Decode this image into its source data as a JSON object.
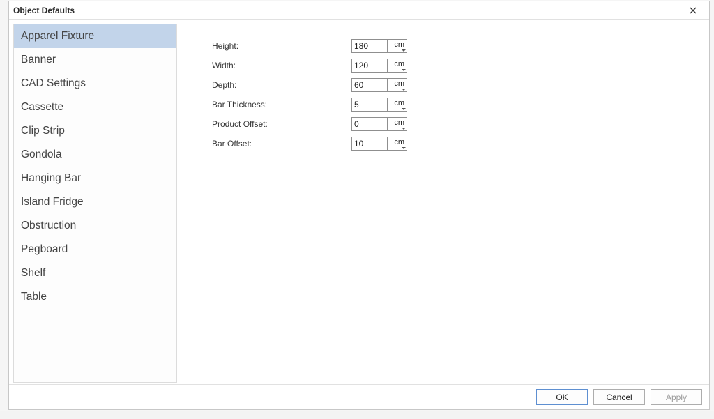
{
  "window": {
    "title": "Object Defaults"
  },
  "sidebar": {
    "items": [
      {
        "label": "Apparel Fixture",
        "selected": true
      },
      {
        "label": "Banner"
      },
      {
        "label": "CAD Settings"
      },
      {
        "label": "Cassette"
      },
      {
        "label": "Clip Strip"
      },
      {
        "label": "Gondola"
      },
      {
        "label": "Hanging Bar"
      },
      {
        "label": "Island Fridge"
      },
      {
        "label": "Obstruction"
      },
      {
        "label": "Pegboard"
      },
      {
        "label": "Shelf"
      },
      {
        "label": "Table"
      }
    ]
  },
  "fields": [
    {
      "label": "Height:",
      "value": "180",
      "unit": "cm"
    },
    {
      "label": "Width:",
      "value": "120",
      "unit": "cm"
    },
    {
      "label": "Depth:",
      "value": "60",
      "unit": "cm"
    },
    {
      "label": "Bar Thickness:",
      "value": "5",
      "unit": "cm"
    },
    {
      "label": "Product Offset:",
      "value": "0",
      "unit": "cm"
    },
    {
      "label": "Bar Offset:",
      "value": "10",
      "unit": "cm"
    }
  ],
  "buttons": {
    "ok": "OK",
    "cancel": "Cancel",
    "apply": "Apply"
  }
}
